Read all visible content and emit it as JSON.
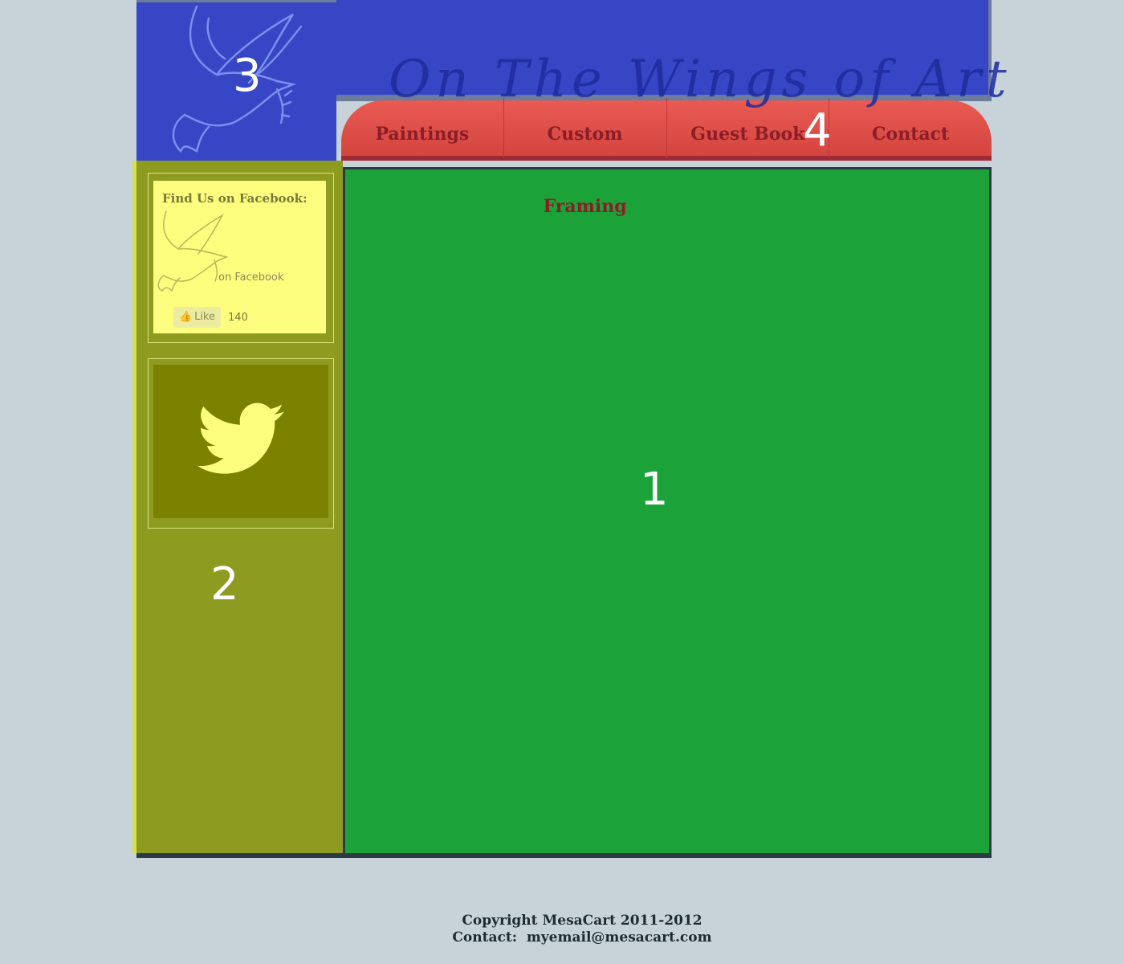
{
  "header": {
    "site_title": "On The Wings of Art",
    "region_label": "3"
  },
  "nav": {
    "items": [
      {
        "label": "Paintings"
      },
      {
        "label": "Custom Framing"
      },
      {
        "label": "Guest Book"
      },
      {
        "label": "Contact"
      }
    ],
    "region_label": "4"
  },
  "sidebar": {
    "facebook": {
      "title": "Find Us on Facebook:",
      "subtitle": "on Facebook",
      "like_label": "Like",
      "like_count": "140"
    },
    "region_label": "2"
  },
  "main": {
    "region_label": "1"
  },
  "footer": {
    "copyright": "Copyright MesaCart 2011-2012",
    "contact": "Contact:  myemail@mesacart.com"
  },
  "colors": {
    "header_blue": "#3646c4",
    "nav_red": "#e85a52",
    "sidebar_olive": "#8e9b21",
    "main_green": "#1ba33a",
    "background": "#c7d3d9"
  }
}
